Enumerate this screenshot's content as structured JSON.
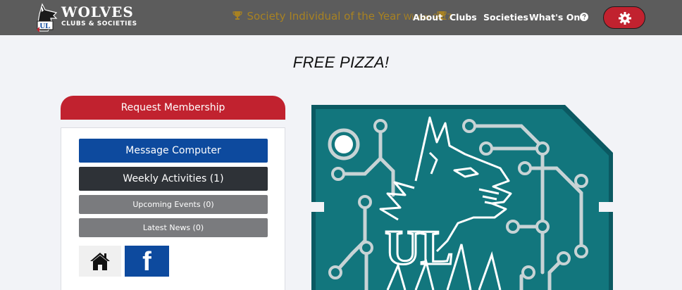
{
  "navbar": {
    "logo": {
      "title": "WOLVES",
      "subtitle": "CLUBS & SOCIETIES",
      "mark_text": "UL"
    },
    "award": {
      "title": "Society Individual of the Year",
      "winner": "Winner 2017"
    },
    "links": [
      {
        "label": "About"
      },
      {
        "label": "Clubs"
      },
      {
        "label": "Societies"
      },
      {
        "label": "What's On"
      }
    ],
    "help_icon": "question-circle-icon",
    "settings_icon": "gear-icon"
  },
  "page": {
    "headline": "FREE PIZZA!"
  },
  "sidebar": {
    "request_label": "Request Membership",
    "buttons": [
      {
        "label": "Message Computer"
      },
      {
        "label": "Weekly Activities (1)"
      },
      {
        "label": "Upcoming Events (0)"
      },
      {
        "label": "Latest News (0)"
      }
    ],
    "social": {
      "home_icon": "home-icon",
      "facebook_icon": "facebook-icon",
      "facebook_letter": "f"
    }
  },
  "club_image": {
    "text": "UL",
    "colors": {
      "teal": "#12767d",
      "dark_teal": "#0b5962",
      "line": "#c7d3d5"
    }
  },
  "colors": {
    "navbar": "#5c5c5c",
    "accent_red": "#c1222f",
    "primary_blue": "#0d4a9e",
    "dark_button": "#2e3237",
    "grey_button": "#7a7b7e",
    "gold": "#a88222"
  }
}
